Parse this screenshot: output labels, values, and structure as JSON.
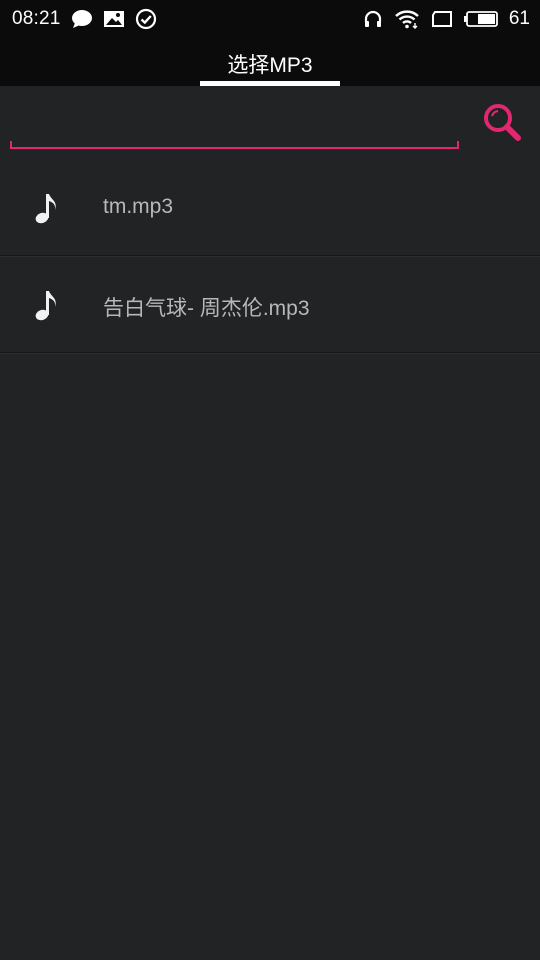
{
  "status_bar": {
    "time": "08:21",
    "battery_percent": "61",
    "icons_left": [
      "chat-bubble-icon",
      "image-icon",
      "check-circle-icon"
    ],
    "icons_right": [
      "headphones-icon",
      "wifi-icon",
      "square-icon",
      "battery-icon"
    ]
  },
  "header": {
    "title": "选择MP3"
  },
  "search": {
    "value": "",
    "placeholder": "",
    "icon": "search-icon",
    "accent_color": "#e0276f"
  },
  "files": [
    {
      "name": "tm.mp3",
      "icon": "music-note-icon"
    },
    {
      "name": "告白气球- 周杰伦.mp3",
      "icon": "music-note-icon"
    }
  ]
}
